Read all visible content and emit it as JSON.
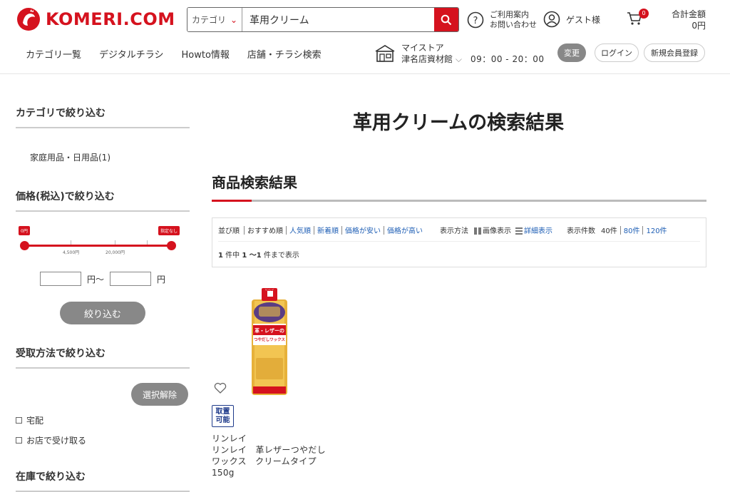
{
  "header": {
    "logo_text": "KOMERI.COM",
    "search": {
      "category_label": "カテゴリ",
      "query": "革用クリーム"
    },
    "help_line1": "ご利用案内",
    "help_line2": "お問い合わせ",
    "guest_label": "ゲスト様",
    "cart_count": "0",
    "total_label": "合計金額",
    "total_value": "0円",
    "nav": [
      "カテゴリ一覧",
      "デジタルチラシ",
      "Howto情報",
      "店舗・チラシ検索"
    ],
    "store_line1": "マイストア",
    "store_line2": "津名店資材館",
    "hours": "09：00 - 20：00",
    "change_label": "変更",
    "login_label": "ログイン",
    "register_label": "新規会員登録"
  },
  "sidebar": {
    "category_heading": "カテゴリで絞り込む",
    "category_item": "家庭用品・日用品(1)",
    "price_heading": "価格(税込)で絞り込む",
    "slider": {
      "min_flag": "0円",
      "max_flag": "指定なし",
      "tick1": "4,500円",
      "tick2": "20,000円"
    },
    "price_unit_from": "円〜",
    "price_unit_to": "円",
    "narrow_button": "絞り込む",
    "pickup_heading": "受取方法で絞り込む",
    "clear_button": "選択解除",
    "pickup_options": [
      "宅配",
      "お店で受け取る"
    ],
    "stock_heading": "在庫で絞り込む"
  },
  "main": {
    "page_title": "革用クリームの検索結果",
    "section_title": "商品検索結果",
    "sort": {
      "label": "並び順",
      "options": [
        "おすすめ順",
        "人気順",
        "新着順",
        "価格が安い",
        "価格が高い"
      ],
      "display_label": "表示方法",
      "image_view": "画像表示",
      "detail_view": "詳細表示",
      "count_label": "表示件数",
      "counts": [
        "40件",
        "80件",
        "120件"
      ]
    },
    "result": {
      "total": "1",
      "mid1": " 件中 ",
      "range": "1 〜1",
      "mid2": " 件まで表示"
    }
  },
  "product": {
    "pickup_badge_line1": "取置",
    "pickup_badge_line2": "可能",
    "name_line1": "リンレイ",
    "name_line2": "リンレイ　革レザーつやだし",
    "name_line3": "ワックス　クリームタイプ",
    "name_line4": "150g",
    "image_label_line1": "革・レザーの",
    "image_label_line2": "つやだしワックス",
    "image_brand": "リンレイ"
  },
  "colors": {
    "brand_red": "#d5121e",
    "link_blue": "#1f5fb5",
    "gray_button": "#888888"
  }
}
